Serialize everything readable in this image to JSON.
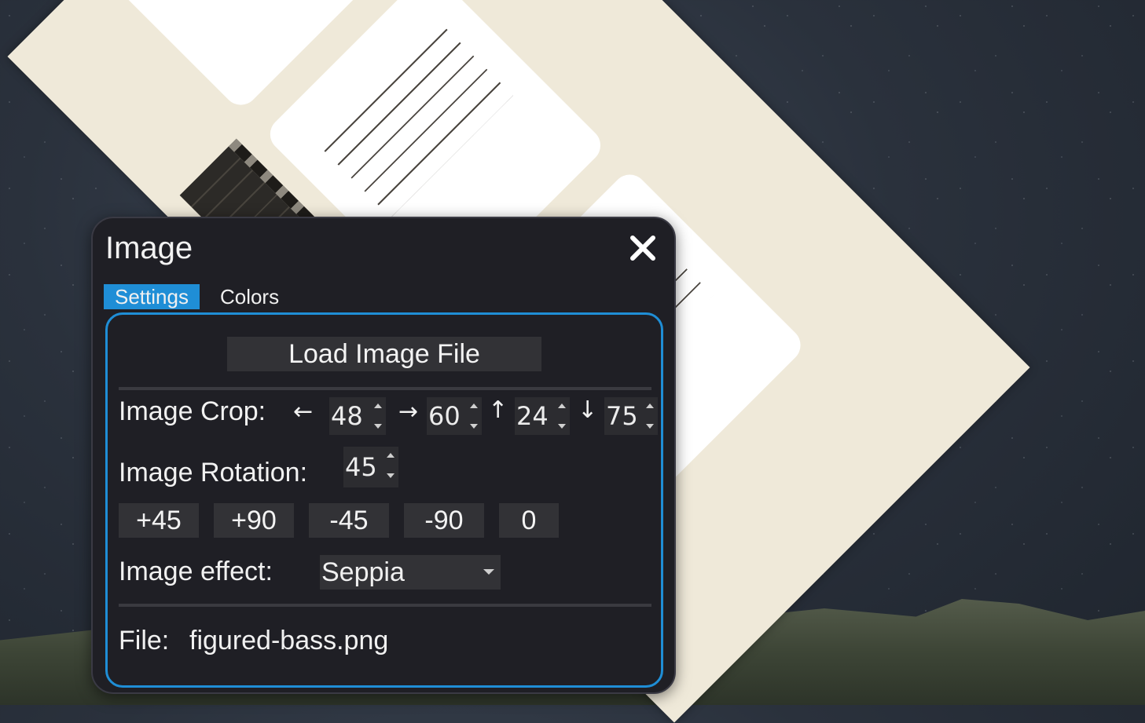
{
  "dialog": {
    "title": "Image",
    "close_label": "✕",
    "tabs": [
      {
        "label": "Settings",
        "active": true
      },
      {
        "label": "Colors",
        "active": false
      }
    ],
    "load_button": "Load Image File",
    "crop": {
      "label": "Image Crop:",
      "left_arrow": "←",
      "right_arrow": "→",
      "up_arrow": "↑",
      "down_arrow": "↓",
      "left": "48",
      "right": "60",
      "top": "24",
      "bottom": "75"
    },
    "rotation": {
      "label": "Image Rotation:",
      "value": "45",
      "buttons": [
        "+45",
        "+90",
        "-45",
        "-90",
        "0"
      ]
    },
    "effect": {
      "label": "Image effect:",
      "value": "Seppia"
    },
    "file": {
      "label": "File:",
      "name": "figured-bass.png"
    }
  },
  "colors": {
    "accent": "#1f8ed6",
    "dialog_bg": "#1f1f25",
    "button_bg": "#323236"
  }
}
